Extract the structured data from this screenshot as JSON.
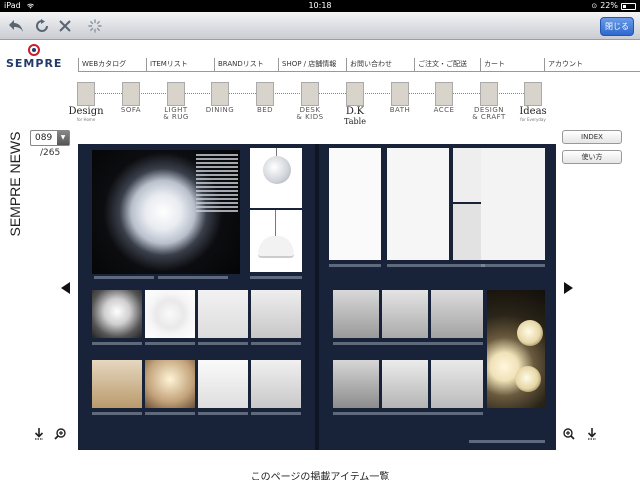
{
  "status": {
    "device": "iPad",
    "time": "10:18",
    "battery": "22%",
    "battery_level": 0.22
  },
  "toolbar": {
    "back_icon": "back-arrow-icon",
    "reload_icon": "reload-icon",
    "stop_icon": "close-icon",
    "loading_icon": "loading-spinner-icon",
    "close_label": "閉じる"
  },
  "brand": {
    "name": "SEMPRE"
  },
  "topnav": [
    "WEBカタログ",
    "ITEMリスト",
    "BRANDリスト",
    "SHOP / 店舗情報",
    "お問い合わせ",
    "ご注文・ご配送",
    "カート",
    "アカウント"
  ],
  "categories": [
    {
      "big": "Design",
      "sub": "for Home"
    },
    {
      "label": "SOFA"
    },
    {
      "label": "LIGHT\n& RUG"
    },
    {
      "label": "DINING"
    },
    {
      "label": "BED"
    },
    {
      "label": "DESK\n& KIDS"
    },
    {
      "big": "D.K",
      "sub2": "Table"
    },
    {
      "label": "BATH"
    },
    {
      "label": "ACCE"
    },
    {
      "label": "DESIGN\n& CRAFT"
    },
    {
      "big": "Ideas",
      "sub": "for Everyday"
    }
  ],
  "side": {
    "title": "SEMPRE NEWS",
    "page": "089",
    "total": "/265"
  },
  "buttons": {
    "index": "INDEX",
    "howto": "使い方"
  },
  "footer": {
    "text": "このページの掲載アイテム一覧"
  },
  "colors": {
    "accent": "#2f68cf",
    "brand_red": "#c81e2c",
    "brand_navy": "#233a6b",
    "magazine_bg": "#18233a"
  }
}
